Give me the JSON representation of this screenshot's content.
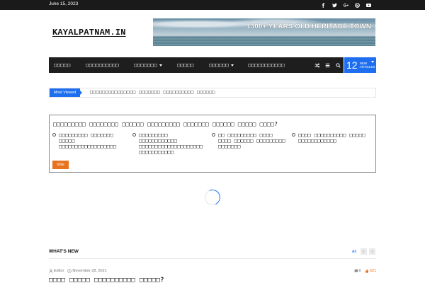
{
  "topbar": {
    "date": "June 15, 2023",
    "social": [
      "facebook-icon",
      "twitter-icon",
      "google-plus-icon",
      "dribbble-icon",
      "youtube-icon"
    ]
  },
  "header": {
    "logo_text": "KAYALPATNAM.IN",
    "banner_text": "1300+ YEARS OLD HERITAGE TOWN"
  },
  "nav": {
    "items": [
      {
        "label": "□□□□□",
        "dropdown": false
      },
      {
        "label": "□□□□□□□□□□",
        "dropdown": false
      },
      {
        "label": "□□□□□□□",
        "dropdown": true
      },
      {
        "label": "□□□□□",
        "dropdown": false
      },
      {
        "label": "□□□□□□",
        "dropdown": true
      },
      {
        "label": "□□□□□□□□□□□",
        "dropdown": false
      }
    ],
    "tools": [
      "shuffle-icon",
      "menu-icon",
      "search-icon"
    ],
    "new_count": "12",
    "new_label_1": "NEW",
    "new_label_2": "ARTICLES"
  },
  "ticker": {
    "label": "Most Viewed",
    "text": "□□□□□□□□□□□□□□□ □□□□□□□ □□□□□□□□□□ □□□□□□"
  },
  "poll": {
    "question": "□□□□□□□□□ □□□□□□□□ □□□□□□ □□□□□□□□□ □□□□□□□ □□□□□□ □□□□□ □□□□?",
    "options": [
      "□□□□□□□□□ □□□□□□□ □□□□□ □□□□□□□□□□□□□□□□□□",
      "□□□□□□□□□ □□□□□□□□□□□□ □□□□□□□□□□□□□□□□□□□□ □□□□□□□□□□□",
      "□□ □□□□□□□□□ □□□□ □□□□ □□□□□□ □□□□□□□□□ □□□□□□□",
      "□□□□ □□□□□□□□□□ □□□□□ □□□□□□□□□□□□"
    ],
    "vote_label": "Vote"
  },
  "whats_new": {
    "title": "WHAT'S NEW",
    "all_label": "All",
    "article": {
      "author": "Editor",
      "date": "November 28, 2021",
      "comments": "0",
      "views": "621",
      "title": "□□□□ □□□□□ □□□□□□□□□□ □□□□□?"
    }
  },
  "colors": {
    "accent": "#1e6ff0",
    "vote": "#e8731e",
    "nav_bg": "#1e1e1e"
  }
}
